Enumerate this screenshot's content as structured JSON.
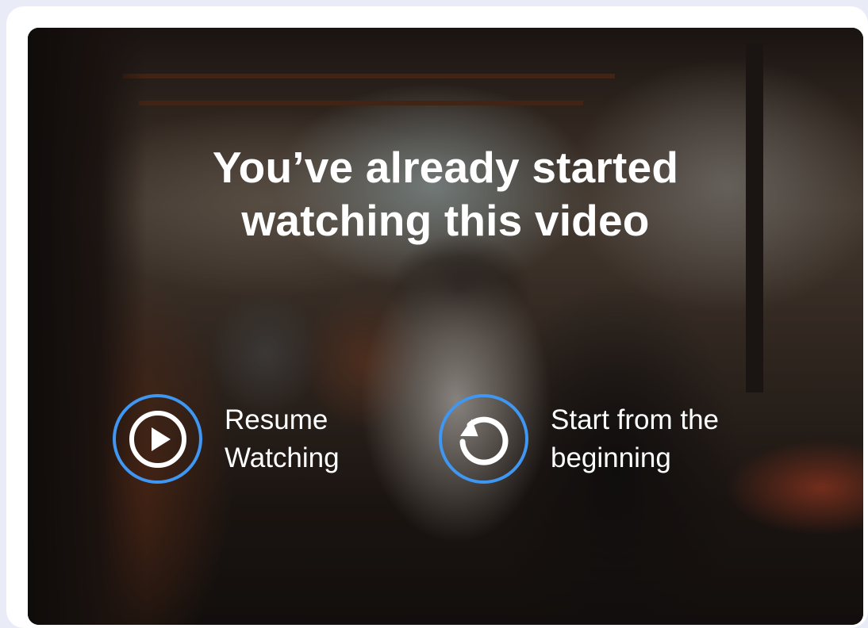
{
  "overlay": {
    "title_line1": "You’ve already started",
    "title_line2": "watching this video"
  },
  "actions": {
    "resume": {
      "label_line1": "Resume",
      "label_line2": "Watching",
      "icon": "play-icon"
    },
    "restart": {
      "label_line1": "Start from the",
      "label_line2": "beginning",
      "icon": "restart-icon"
    }
  },
  "colors": {
    "accent_ring": "#3f97f2",
    "text": "#ffffff",
    "page_background": "#e9ecf7",
    "card_background": "#ffffff"
  }
}
